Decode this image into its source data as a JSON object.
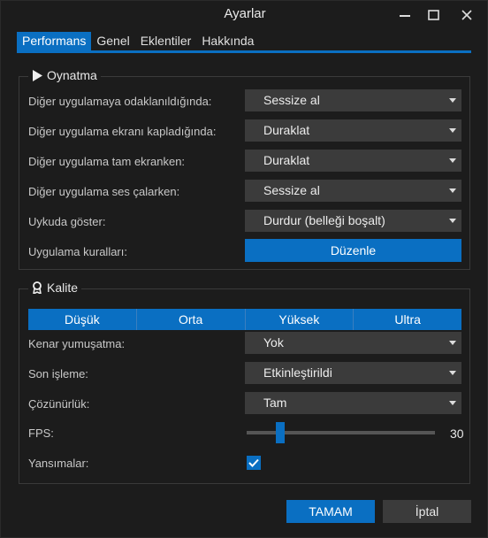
{
  "window": {
    "title": "Ayarlar"
  },
  "tabs": [
    {
      "label": "Performans"
    },
    {
      "label": "Genel"
    },
    {
      "label": "Eklentiler"
    },
    {
      "label": "Hakkında"
    }
  ],
  "playback": {
    "title": "Oynatma",
    "rows": [
      {
        "label": "Diğer uygulamaya odaklanıldığında:",
        "value": "Sessize al"
      },
      {
        "label": "Diğer uygulama ekranı kapladığında:",
        "value": "Duraklat"
      },
      {
        "label": "Diğer uygulama tam ekranken:",
        "value": "Duraklat"
      },
      {
        "label": "Diğer uygulama ses çalarken:",
        "value": "Sessize al"
      },
      {
        "label": "Uykuda göster:",
        "value": "Durdur (belleği boşalt)"
      }
    ],
    "rules_label": "Uygulama kuralları:",
    "edit_button": "Düzenle"
  },
  "quality": {
    "title": "Kalite",
    "presets": [
      "Düşük",
      "Orta",
      "Yüksek",
      "Ultra"
    ],
    "antialias_label": "Kenar yumuşatma:",
    "antialias_value": "Yok",
    "postprocess_label": "Son işleme:",
    "postprocess_value": "Etkinleştirildi",
    "resolution_label": "Çözünürlük:",
    "resolution_value": "Tam",
    "fps_label": "FPS:",
    "fps_value": "30",
    "fps_fraction": 0.18,
    "reflections_label": "Yansımalar:",
    "reflections_checked": true
  },
  "footer": {
    "ok": "TAMAM",
    "cancel": "İptal"
  },
  "colors": {
    "accent": "#0a6fc2",
    "background": "#1c1c1c",
    "control": "#3b3b3b"
  }
}
